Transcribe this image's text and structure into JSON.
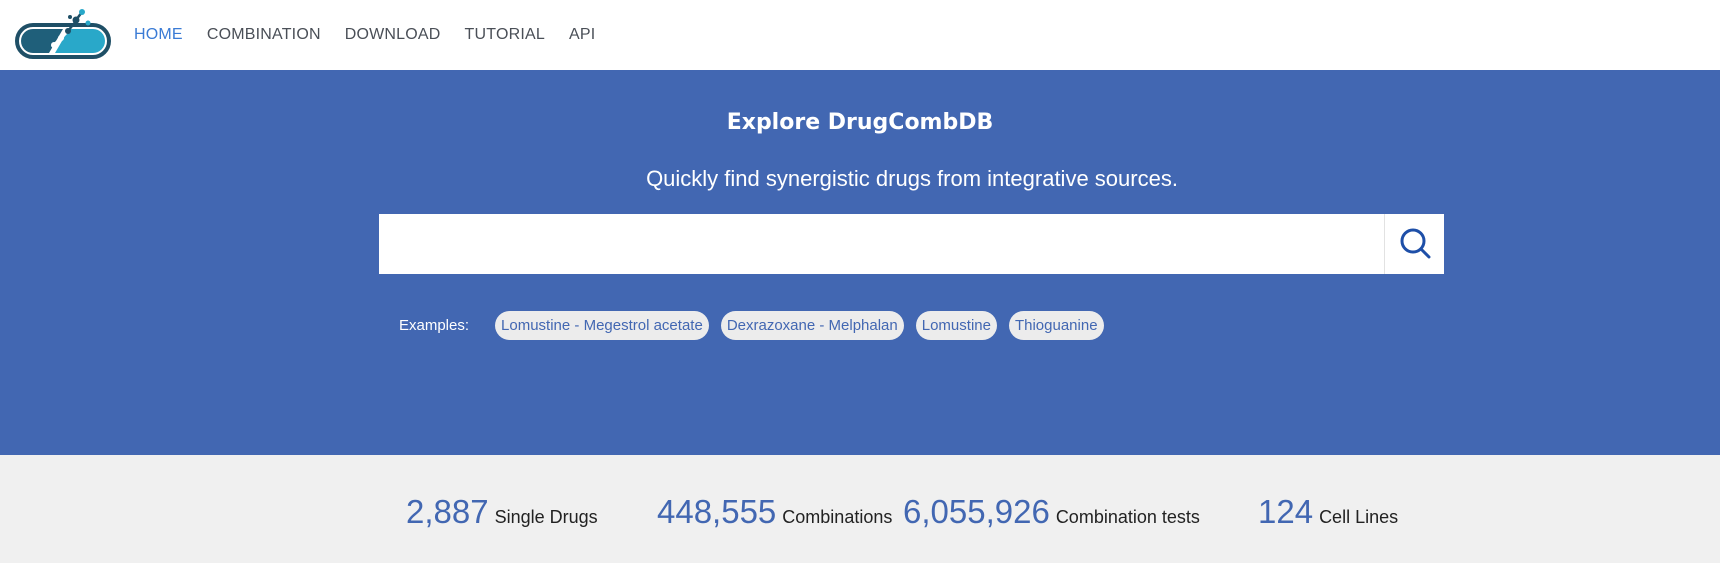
{
  "brand": {
    "logo_icon": "capsule-molecule-logo",
    "colors": {
      "primary": "#4267b2",
      "accent": "#3a7bd5",
      "logo_dark": "#1f5f7a",
      "logo_light": "#29a8c9"
    }
  },
  "nav": {
    "items": [
      {
        "label": "HOME",
        "active": true
      },
      {
        "label": "COMBINATION",
        "active": false
      },
      {
        "label": "DOWNLOAD",
        "active": false
      },
      {
        "label": "TUTORIAL",
        "active": false
      },
      {
        "label": "API",
        "active": false
      }
    ]
  },
  "hero": {
    "title": "Explore DrugCombDB",
    "subtitle": "Quickly find synergistic drugs from integrative sources.",
    "search": {
      "value": "",
      "placeholder": "",
      "button_icon": "search-icon"
    },
    "examples_label": "Examples:",
    "examples": [
      "Lomustine - Megestrol acetate",
      "Dexrazoxane - Melphalan",
      "Lomustine",
      "Thioguanine"
    ]
  },
  "stats": [
    {
      "value": "2,887",
      "label": "Single Drugs"
    },
    {
      "value": "448,555",
      "label": "Combinations"
    },
    {
      "value": "6,055,926",
      "label": "Combination tests"
    },
    {
      "value": "124",
      "label": "Cell Lines"
    }
  ]
}
